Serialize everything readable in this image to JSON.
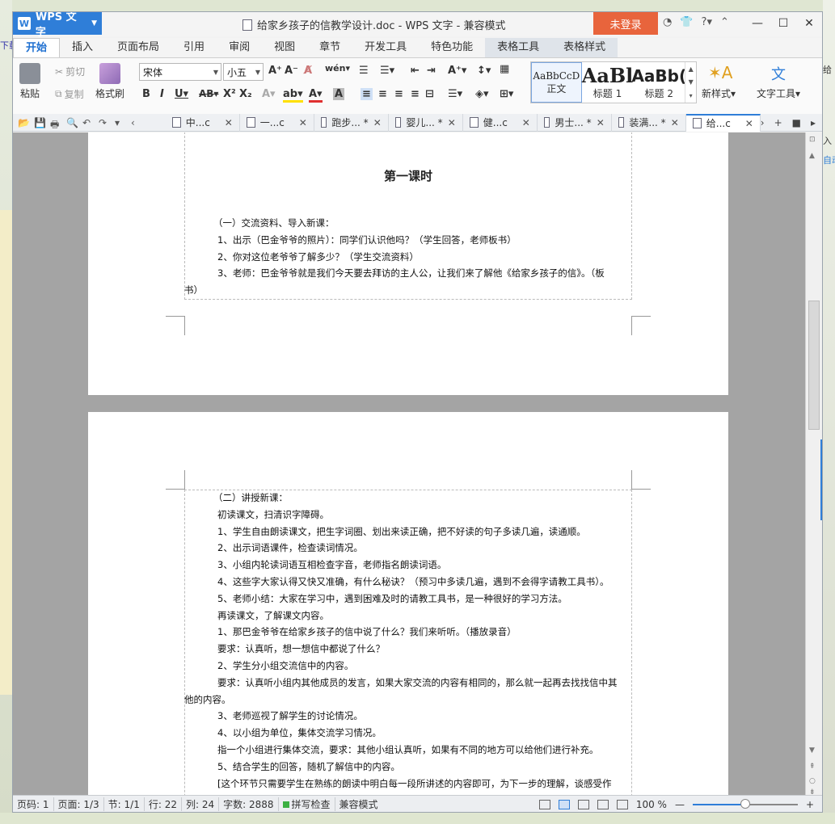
{
  "window": {
    "app_name": "WPS 文字",
    "title": "给家乡孩子的信教学设计.doc - WPS 文字 - 兼容模式",
    "login_label": "未登录",
    "help_label": "?"
  },
  "menu_tabs": [
    "开始",
    "插入",
    "页面布局",
    "引用",
    "审阅",
    "视图",
    "章节",
    "开发工具",
    "特色功能",
    "表格工具",
    "表格样式"
  ],
  "ribbon": {
    "paste": "粘贴",
    "cut": "剪切",
    "copy": "复制",
    "format_painter": "格式刷",
    "font_name": "宋体",
    "font_size": "小五",
    "styles": [
      {
        "preview": "AaBbCcD",
        "name": "正文"
      },
      {
        "preview": "AaBl",
        "name": "标题 1"
      },
      {
        "preview": "AaBb(",
        "name": "标题 2"
      }
    ],
    "new_style": "新样式",
    "text_tools": "文字工具"
  },
  "doc_tabs": [
    {
      "label": "中...c",
      "active": false
    },
    {
      "label": "一...c",
      "active": false
    },
    {
      "label": "跑步... *",
      "active": false
    },
    {
      "label": "婴儿... *",
      "active": false
    },
    {
      "label": "健...c",
      "active": false
    },
    {
      "label": "男士... *",
      "active": false
    },
    {
      "label": "装满... *",
      "active": false
    },
    {
      "label": "给...c",
      "active": true
    }
  ],
  "document": {
    "page1": {
      "heading": "第一课时",
      "lines": [
        "（一）交流资料、导入新课：",
        "1、出示（巴金爷爷的照片）：同学们认识他吗？（学生回答，老师板书）",
        "2、你对这位老爷爷了解多少？（学生交流资料）",
        "3、老师：巴金爷爷就是我们今天要去拜访的主人公，让我们来了解他《给家乡孩子的信》。（板",
        "书）"
      ]
    },
    "page2": {
      "lines": [
        "（二）讲授新课：",
        "初读课文，扫清识字障碍。",
        "1、学生自由朗读课文，把生字词圈、划出来读正确，把不好读的句子多读几遍，读通顺。",
        "2、出示词语课件，检查读词情况。",
        "3、小组内轮读词语互相检查字音，老师指名朗读词语。",
        "4、这些字大家认得又快又准确，有什么秘诀？（预习中多读几遍，遇到不会得字请教工具书）。",
        "5、老师小结：大家在学习中，遇到困难及时的请教工具书，是一种很好的学习方法。",
        "再读课文，了解课文内容。",
        "1、那巴金爷爷在给家乡孩子的信中说了什么？我们来听听。（播放录音）",
        "要求：认真听，想一想信中都说了什么？",
        "2、学生分小组交流信中的内容。",
        "要求：认真听小组内其他成员的发言，如果大家交流的内容有相同的，那么就一起再去找找信中其",
        "他的内容。",
        "3、老师巡视了解学生的讨论情况。",
        "4、以小组为单位，集体交流学习情况。",
        "指一个小组进行集体交流，要求：其他小组认真听，如果有不同的地方可以给他们进行补充。",
        "5、结合学生的回答，随机了解信中的内容。",
        "[这个环节只需要学生在熟练的朗读中明白每一段所讲述的内容即可，为下一步的理解，谈感受作"
      ]
    }
  },
  "status": {
    "page_code": "页码: 1",
    "pages": "页面: 1/3",
    "section": "节: 1/1",
    "row": "行: 22",
    "col": "列: 24",
    "word_count": "字数: 2888",
    "spell_check": "拼写检查",
    "compat_mode": "兼容模式",
    "zoom": "100 %",
    "zoom_level": 0.5
  },
  "desktop_fragments": {
    "left_top": "下载",
    "right_1": "给",
    "right_2": "入",
    "right_3": "自动"
  },
  "colors": {
    "accent": "#2f7ed8",
    "login": "#e8643c",
    "spell_ok": "#3cb043"
  }
}
